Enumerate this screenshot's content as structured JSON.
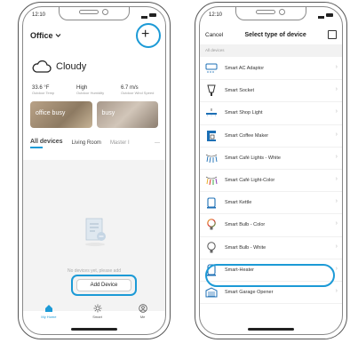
{
  "left_phone": {
    "status_time": "12:10",
    "title": "Office",
    "title_chevron": "chevron-down-icon",
    "add_icon": "+",
    "weather": {
      "label": "Cloudy",
      "icon": "cloud-icon"
    },
    "stats": [
      {
        "value": "33.6 °F",
        "label": "Outdoor Temp"
      },
      {
        "value": "High",
        "label": "Outdoor Humidity"
      },
      {
        "value": "6.7 m/s",
        "label": "Outdoor Wind Speed"
      }
    ],
    "rooms": [
      {
        "label": "office busy"
      },
      {
        "label": "busy"
      }
    ],
    "tabs": [
      {
        "label": "All devices"
      },
      {
        "label": "Living Room"
      },
      {
        "label": "Master I"
      }
    ],
    "tabs_more": "···",
    "empty_text": "No devices yet, please add",
    "add_button": "Add Device",
    "nav": [
      {
        "label": "My Home",
        "icon": "home-icon"
      },
      {
        "label": "Smart",
        "icon": "sun-icon"
      },
      {
        "label": "Me",
        "icon": "profile-icon"
      }
    ],
    "accent": "#1c9ad6"
  },
  "right_phone": {
    "status_time": "12:10",
    "cancel": "Cancel",
    "title": "Select type of device",
    "section_header": "All devices",
    "devices": [
      {
        "label": "Smart AC Adaptor",
        "icon": "ac-adaptor-icon"
      },
      {
        "label": "Smart Socket",
        "icon": "socket-icon"
      },
      {
        "label": "Smart Shop Light",
        "icon": "shop-light-icon"
      },
      {
        "label": "Smart Coffee Maker",
        "icon": "coffee-maker-icon"
      },
      {
        "label": "Smart Café Lights - White",
        "icon": "cafe-lights-white-icon"
      },
      {
        "label": "Smart Café Light-Color",
        "icon": "cafe-lights-color-icon"
      },
      {
        "label": "Smart Kettle",
        "icon": "kettle-icon"
      },
      {
        "label": "Smart Bulb - Color",
        "icon": "bulb-color-icon"
      },
      {
        "label": "Smart Bulb - White",
        "icon": "bulb-white-icon"
      },
      {
        "label": "Smart-Heater",
        "icon": "heater-icon"
      },
      {
        "label": "Smart Garage Opener",
        "icon": "garage-icon"
      }
    ],
    "chevron": "›",
    "highlight_color": "#1c9ad6"
  }
}
